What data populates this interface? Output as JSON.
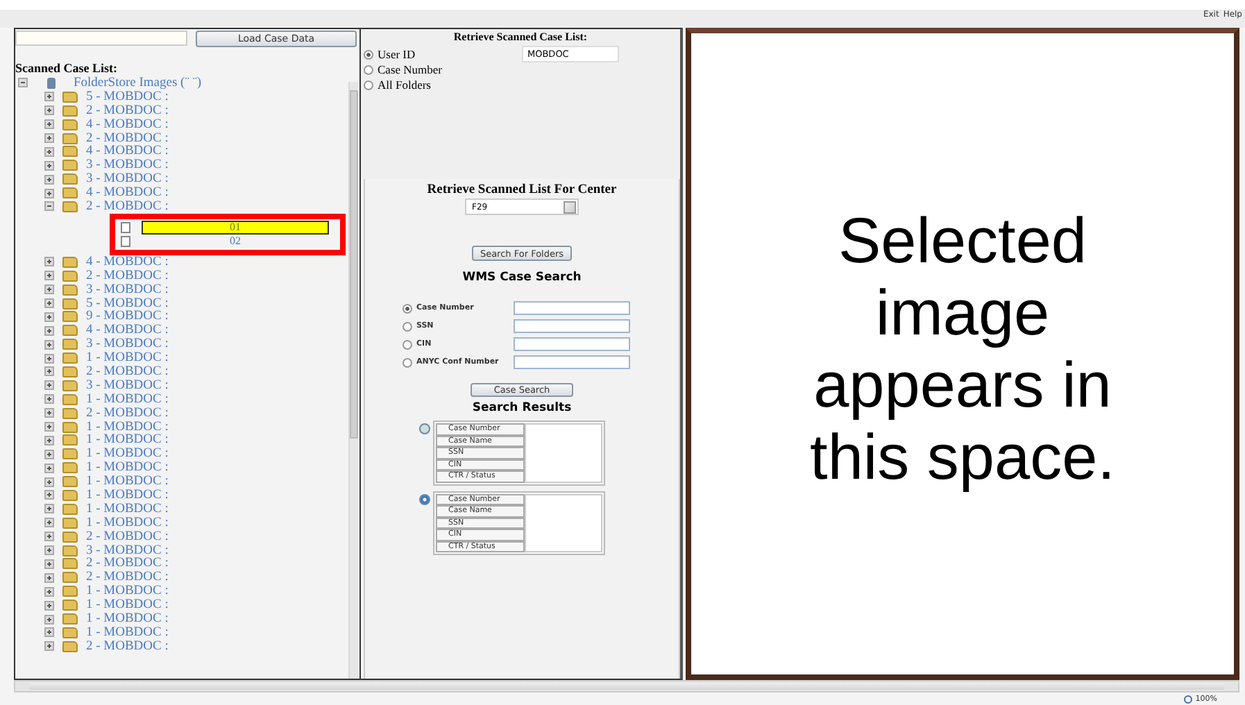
{
  "top_bar": {
    "links": [
      "Exit",
      "Help"
    ]
  },
  "left_panel": {
    "load_button": "Load Case Data",
    "heading": "Scanned Case List:",
    "tree": {
      "label": "FolderStore Images (¨ ¨)",
      "expanded": true,
      "children": [
        {
          "label": "5 - MOBDOC :",
          "expanded": false
        },
        {
          "label": "2 - MOBDOC :",
          "expanded": false
        },
        {
          "label": "4 - MOBDOC :",
          "expanded": false
        },
        {
          "label": "2 - MOBDOC :",
          "expanded": false
        },
        {
          "label": "4 - MOBDOC :",
          "expanded": false
        },
        {
          "label": "3 - MOBDOC :",
          "expanded": false
        },
        {
          "label": "3 - MOBDOC :",
          "expanded": false
        },
        {
          "label": "4 - MOBDOC :",
          "expanded": false
        },
        {
          "label": "2 - MOBDOC :",
          "expanded": true,
          "highlighted": true,
          "children": [
            {
              "label": "01",
              "selected": true
            },
            {
              "label": "02",
              "selected": false
            }
          ]
        },
        {
          "label": "4 - MOBDOC :",
          "expanded": false
        },
        {
          "label": "2 - MOBDOC :",
          "expanded": false
        },
        {
          "label": "3 - MOBDOC :",
          "expanded": false
        },
        {
          "label": "5 - MOBDOC :",
          "expanded": false
        },
        {
          "label": "9 - MOBDOC :",
          "expanded": false
        },
        {
          "label": "4 - MOBDOC :",
          "expanded": false
        },
        {
          "label": "3 - MOBDOC :",
          "expanded": false
        },
        {
          "label": "1 - MOBDOC :",
          "expanded": false
        },
        {
          "label": "2 - MOBDOC :",
          "expanded": false
        },
        {
          "label": "3 - MOBDOC :",
          "expanded": false
        },
        {
          "label": "1 - MOBDOC :",
          "expanded": false
        },
        {
          "label": "2 - MOBDOC :",
          "expanded": false
        },
        {
          "label": "1 - MOBDOC :",
          "expanded": false
        },
        {
          "label": "1 - MOBDOC :",
          "expanded": false
        },
        {
          "label": "1 - MOBDOC :",
          "expanded": false
        },
        {
          "label": "1 - MOBDOC :",
          "expanded": false
        },
        {
          "label": "1 - MOBDOC :",
          "expanded": false
        },
        {
          "label": "1 - MOBDOC :",
          "expanded": false
        },
        {
          "label": "1 - MOBDOC :",
          "expanded": false
        },
        {
          "label": "1 - MOBDOC :",
          "expanded": false
        },
        {
          "label": "2 - MOBDOC :",
          "expanded": false
        },
        {
          "label": "3 - MOBDOC :",
          "expanded": false
        },
        {
          "label": "2 - MOBDOC :",
          "expanded": false
        },
        {
          "label": "2 - MOBDOC :",
          "expanded": false
        },
        {
          "label": "1 - MOBDOC :",
          "expanded": false
        },
        {
          "label": "1 - MOBDOC :",
          "expanded": false
        },
        {
          "label": "1 - MOBDOC :",
          "expanded": false
        },
        {
          "label": "1 - MOBDOC :",
          "expanded": false
        },
        {
          "label": "2 - MOBDOC :",
          "expanded": false
        }
      ]
    }
  },
  "middle_panel": {
    "retrieve_list": {
      "title": "Retrieve Scanned Case List:",
      "options": [
        {
          "label": "User ID",
          "selected": true
        },
        {
          "label": "Case Number",
          "selected": false
        },
        {
          "label": "All Folders",
          "selected": false
        }
      ],
      "user_field": {
        "value": "MOBDOC"
      }
    },
    "center": {
      "title": "Retrieve Scanned List For Center",
      "select": {
        "value": "F29"
      },
      "button": "Search For Folders"
    },
    "wms": {
      "title": "WMS Case Search",
      "options": [
        {
          "label": "Case Number",
          "selected": true
        },
        {
          "label": "SSN",
          "selected": false
        },
        {
          "label": "CIN",
          "selected": false
        },
        {
          "label": "ANYC Conf Number",
          "selected": false
        }
      ],
      "button": "Case Search"
    },
    "results": {
      "title": "Search Results",
      "tables": [
        {
          "selected": false,
          "labels": [
            "Case Number",
            "Case Name",
            "SSN",
            "CIN",
            "CTR / Status"
          ]
        },
        {
          "selected": true,
          "labels": [
            "Case Number",
            "Case Name",
            "SSN",
            "CIN",
            "CTR / Status"
          ]
        }
      ]
    }
  },
  "image_panel": {
    "message": "Selected image appears in this space."
  },
  "status_bar": {
    "zoom": "100%"
  }
}
